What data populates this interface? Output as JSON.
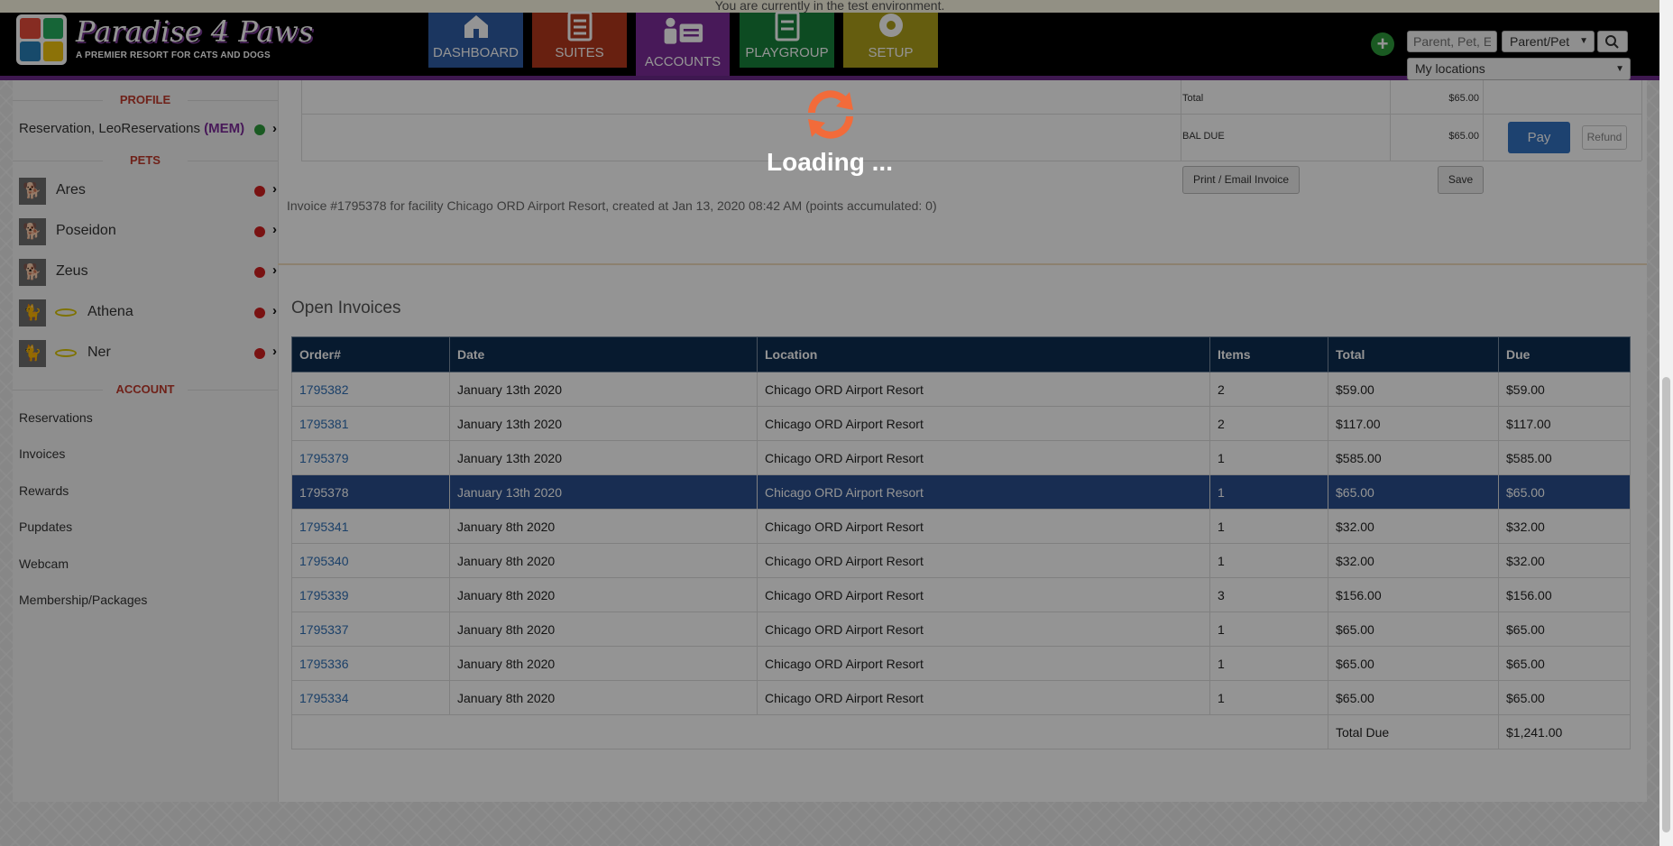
{
  "banner": {
    "text": "You are currently in the test environment."
  },
  "brand": {
    "title": "Paradise 4 Paws",
    "subtitle": "A PREMIER RESORT FOR CATS AND DOGS"
  },
  "nav": {
    "dashboard": "DASHBOARD",
    "suites": "SUITES",
    "accounts": "ACCOUNTS",
    "playgroup": "PLAYGROUP",
    "setup": "SETUP"
  },
  "search": {
    "placeholder": "Parent, Pet, E",
    "type": "Parent/Pet",
    "location": "My locations"
  },
  "sidebar": {
    "profile_heading": "PROFILE",
    "profile_name": "Reservation, LeoReservations",
    "profile_tag": "(MEM)",
    "pets_heading": "PETS",
    "pets": [
      {
        "name": "Ares"
      },
      {
        "name": "Poseidon"
      },
      {
        "name": "Zeus"
      },
      {
        "name": "Athena"
      },
      {
        "name": "Ner"
      }
    ],
    "account_heading": "ACCOUNT",
    "account_links": [
      "Reservations",
      "Invoices",
      "Rewards",
      "Pupdates",
      "Webcam",
      "Membership/Packages"
    ]
  },
  "summary": {
    "total_label": "Total",
    "total_value": "$65.00",
    "bal_label": "BAL DUE",
    "bal_value": "$65.00",
    "pay_label": "Pay",
    "refund_label": "Refund",
    "print_label": "Print / Email Invoice",
    "save_label": "Save",
    "invoice_note": "Invoice #1795378 for facility Chicago ORD Airport Resort, created at Jan 13, 2020 08:42 AM (points accumulated: 0)"
  },
  "open_invoices": {
    "title": "Open Invoices",
    "columns": [
      "Order#",
      "Date",
      "Location",
      "Items",
      "Total",
      "Due"
    ],
    "rows": [
      [
        "1795382",
        "January 13th 2020",
        "Chicago ORD Airport Resort",
        "2",
        "$59.00",
        "$59.00"
      ],
      [
        "1795381",
        "January 13th 2020",
        "Chicago ORD Airport Resort",
        "2",
        "$117.00",
        "$117.00"
      ],
      [
        "1795379",
        "January 13th 2020",
        "Chicago ORD Airport Resort",
        "1",
        "$585.00",
        "$585.00"
      ],
      [
        "1795378",
        "January 13th 2020",
        "Chicago ORD Airport Resort",
        "1",
        "$65.00",
        "$65.00"
      ],
      [
        "1795341",
        "January 8th 2020",
        "Chicago ORD Airport Resort",
        "1",
        "$32.00",
        "$32.00"
      ],
      [
        "1795340",
        "January 8th 2020",
        "Chicago ORD Airport Resort",
        "1",
        "$32.00",
        "$32.00"
      ],
      [
        "1795339",
        "January 8th 2020",
        "Chicago ORD Airport Resort",
        "3",
        "$156.00",
        "$156.00"
      ],
      [
        "1795337",
        "January 8th 2020",
        "Chicago ORD Airport Resort",
        "1",
        "$65.00",
        "$65.00"
      ],
      [
        "1795336",
        "January 8th 2020",
        "Chicago ORD Airport Resort",
        "1",
        "$65.00",
        "$65.00"
      ],
      [
        "1795334",
        "January 8th 2020",
        "Chicago ORD Airport Resort",
        "1",
        "$65.00",
        "$65.00"
      ]
    ],
    "selected_order": "1795378",
    "total_due_label": "Total Due",
    "total_due_value": "$1,241.00"
  },
  "loading": {
    "text": "Loading ..."
  },
  "colors": {
    "accent_purple": "#7d2c9a",
    "header_navy": "#0d2d52",
    "loader_orange": "#f26b3a",
    "status_green": "#2e9c3c",
    "status_red": "#d11f1f"
  }
}
